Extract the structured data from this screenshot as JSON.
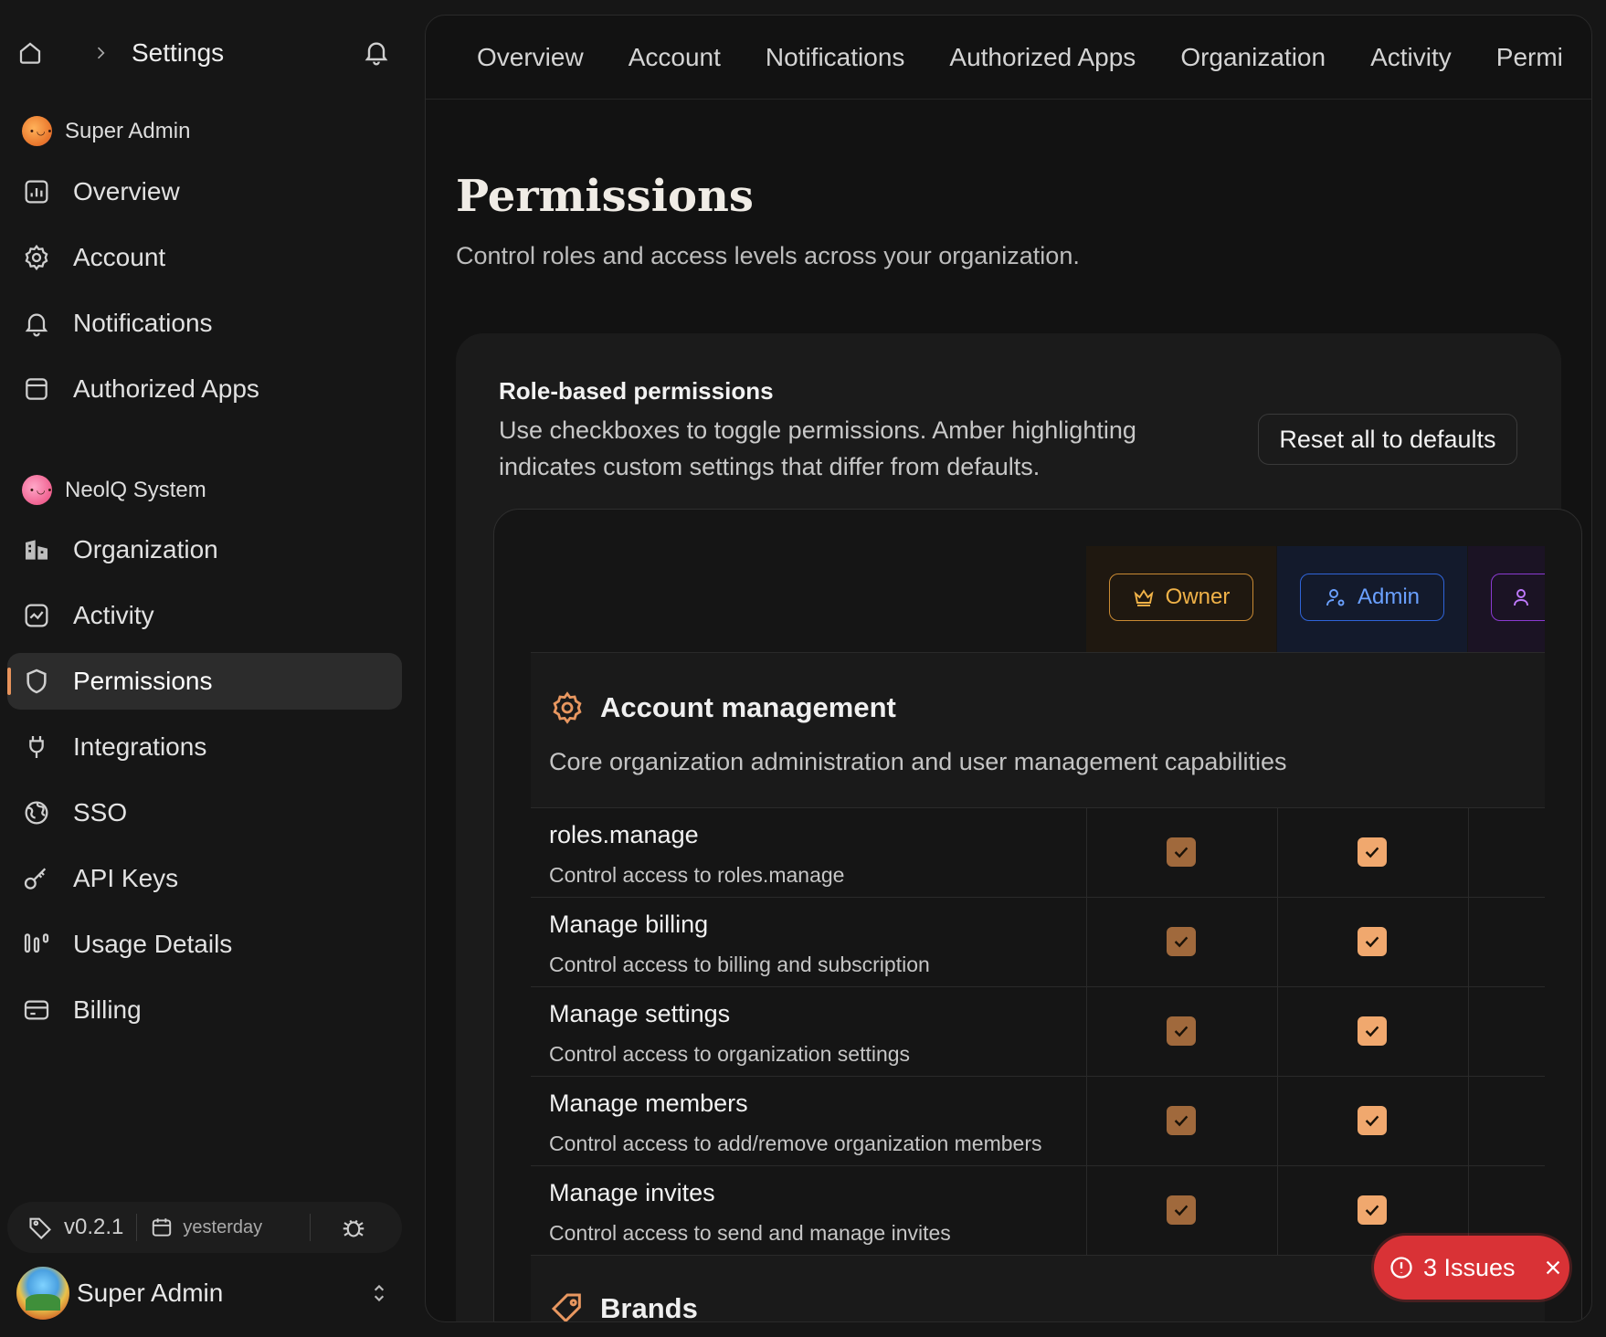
{
  "breadcrumb": {
    "title": "Settings"
  },
  "orgs": [
    {
      "name": "Super Admin",
      "items": [
        {
          "label": "Overview",
          "icon": "chart-icon"
        },
        {
          "label": "Account",
          "icon": "gear-icon"
        },
        {
          "label": "Notifications",
          "icon": "bell-icon"
        },
        {
          "label": "Authorized Apps",
          "icon": "app-window-icon"
        }
      ]
    },
    {
      "name": "NeolQ System",
      "items": [
        {
          "label": "Organization",
          "icon": "building-icon"
        },
        {
          "label": "Activity",
          "icon": "activity-icon"
        },
        {
          "label": "Permissions",
          "icon": "shield-icon"
        },
        {
          "label": "Integrations",
          "icon": "plug-icon"
        },
        {
          "label": "SSO",
          "icon": "globe-icon"
        },
        {
          "label": "API Keys",
          "icon": "key-icon"
        },
        {
          "label": "Usage Details",
          "icon": "usage-bars-icon"
        },
        {
          "label": "Billing",
          "icon": "credit-card-icon"
        }
      ]
    }
  ],
  "active_nav": "Permissions",
  "version": {
    "tag": "v0.2.1",
    "date": "yesterday"
  },
  "user": {
    "name": "Super Admin"
  },
  "tabs": [
    "Overview",
    "Account",
    "Notifications",
    "Authorized Apps",
    "Organization",
    "Activity",
    "Permi"
  ],
  "page": {
    "title": "Permissions",
    "subtitle": "Control roles and access levels across your organization."
  },
  "card": {
    "title": "Role-based permissions",
    "description": "Use checkboxes to toggle permissions. Amber highlighting indicates custom settings that differ from defaults.",
    "reset_label": "Reset all to defaults"
  },
  "roles": [
    {
      "name": "Owner",
      "color": "#f0b248"
    },
    {
      "name": "Admin",
      "color": "#6aa0ff"
    },
    {
      "name": "",
      "color": "#c07aff"
    }
  ],
  "sections": [
    {
      "title": "Account management",
      "description": "Core organization administration and user management capabilities",
      "permissions": [
        {
          "title": "roles.manage",
          "description": "Control access to roles.manage",
          "owner": true,
          "admin": true
        },
        {
          "title": "Manage billing",
          "description": "Control access to billing and subscription",
          "owner": true,
          "admin": true
        },
        {
          "title": "Manage settings",
          "description": "Control access to organization settings",
          "owner": true,
          "admin": true
        },
        {
          "title": "Manage members",
          "description": "Control access to add/remove organization members",
          "owner": true,
          "admin": true
        },
        {
          "title": "Manage invites",
          "description": "Control access to send and manage invites",
          "owner": true,
          "admin": true
        }
      ]
    },
    {
      "title": "Brands"
    }
  ],
  "issues": {
    "label": "3 Issues"
  }
}
